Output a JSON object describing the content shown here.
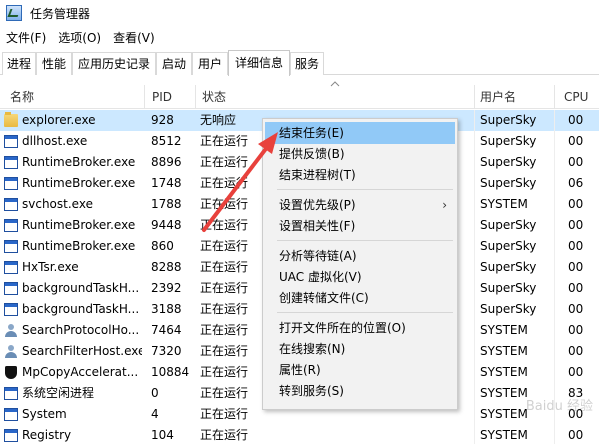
{
  "window": {
    "title": "任务管理器"
  },
  "menu": [
    "文件(F)",
    "选项(O)",
    "查看(V)"
  ],
  "tabs": [
    {
      "label": "进程",
      "active": false
    },
    {
      "label": "性能",
      "active": false
    },
    {
      "label": "应用历史记录",
      "active": false
    },
    {
      "label": "启动",
      "active": false
    },
    {
      "label": "用户",
      "active": false
    },
    {
      "label": "详细信息",
      "active": true
    },
    {
      "label": "服务",
      "active": false
    }
  ],
  "columns": {
    "name": "名称",
    "pid": "PID",
    "status": "状态",
    "user": "用户名",
    "cpu": "CPU"
  },
  "processes": [
    {
      "icon": "folder-icon",
      "name": "explorer.exe",
      "pid": "928",
      "status": "无响应",
      "user": "SuperSky",
      "cpu": "00",
      "selected": true
    },
    {
      "icon": "window-icon",
      "name": "dllhost.exe",
      "pid": "8512",
      "status": "正在运行",
      "user": "SuperSky",
      "cpu": "00"
    },
    {
      "icon": "window-icon",
      "name": "RuntimeBroker.exe",
      "pid": "8896",
      "status": "正在运行",
      "user": "SuperSky",
      "cpu": "00"
    },
    {
      "icon": "window-icon",
      "name": "RuntimeBroker.exe",
      "pid": "1748",
      "status": "正在运行",
      "user": "SuperSky",
      "cpu": "06"
    },
    {
      "icon": "window-icon",
      "name": "svchost.exe",
      "pid": "1788",
      "status": "正在运行",
      "user": "SYSTEM",
      "cpu": "00"
    },
    {
      "icon": "window-icon",
      "name": "RuntimeBroker.exe",
      "pid": "9448",
      "status": "正在运行",
      "user": "SuperSky",
      "cpu": "00"
    },
    {
      "icon": "window-icon",
      "name": "RuntimeBroker.exe",
      "pid": "860",
      "status": "正在运行",
      "user": "SuperSky",
      "cpu": "00"
    },
    {
      "icon": "window-icon",
      "name": "HxTsr.exe",
      "pid": "8288",
      "status": "正在运行",
      "user": "SuperSky",
      "cpu": "00"
    },
    {
      "icon": "window-icon",
      "name": "backgroundTaskH...",
      "pid": "2392",
      "status": "正在运行",
      "user": "SuperSky",
      "cpu": "00"
    },
    {
      "icon": "window-icon",
      "name": "backgroundTaskH...",
      "pid": "3188",
      "status": "正在运行",
      "user": "SuperSky",
      "cpu": "00"
    },
    {
      "icon": "person-icon",
      "name": "SearchProtocolHo...",
      "pid": "7464",
      "status": "正在运行",
      "user": "SYSTEM",
      "cpu": "00"
    },
    {
      "icon": "person-icon",
      "name": "SearchFilterHost.exe",
      "pid": "7320",
      "status": "正在运行",
      "user": "SYSTEM",
      "cpu": "00"
    },
    {
      "icon": "shield-icon",
      "name": "MpCopyAccelerat...",
      "pid": "10884",
      "status": "正在运行",
      "user": "SYSTEM",
      "cpu": "00"
    },
    {
      "icon": "window-icon",
      "name": "系统空闲进程",
      "pid": "0",
      "status": "正在运行",
      "user": "SYSTEM",
      "cpu": "83"
    },
    {
      "icon": "window-icon",
      "name": "System",
      "pid": "4",
      "status": "正在运行",
      "user": "SYSTEM",
      "cpu": "00"
    },
    {
      "icon": "window-icon",
      "name": "Registry",
      "pid": "104",
      "status": "正在运行",
      "user": "SYSTEM",
      "cpu": "00"
    }
  ],
  "context_menu": {
    "groups": [
      [
        {
          "label": "结束任务(E)",
          "highlight": true
        },
        {
          "label": "提供反馈(B)"
        },
        {
          "label": "结束进程树(T)"
        }
      ],
      [
        {
          "label": "设置优先级(P)",
          "submenu": true
        },
        {
          "label": "设置相关性(F)"
        }
      ],
      [
        {
          "label": "分析等待链(A)"
        },
        {
          "label": "UAC 虚拟化(V)"
        },
        {
          "label": "创建转储文件(C)"
        }
      ],
      [
        {
          "label": "打开文件所在的位置(O)"
        },
        {
          "label": "在线搜索(N)"
        },
        {
          "label": "属性(R)"
        },
        {
          "label": "转到服务(S)"
        }
      ]
    ]
  },
  "colors": {
    "selected_row": "#cce8ff",
    "menu_highlight": "#91c9f7",
    "arrow": "#e8413c"
  },
  "watermark": "Baidu 经验"
}
